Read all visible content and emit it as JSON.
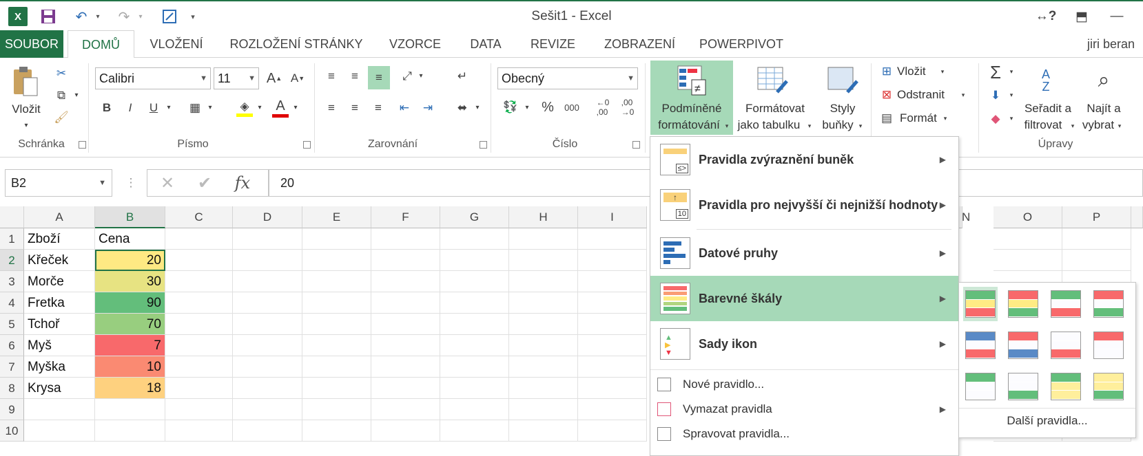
{
  "window": {
    "title": "Sešit1 - Excel",
    "user": "jiri beran"
  },
  "tabs": [
    "SOUBOR",
    "DOMŮ",
    "VLOŽENÍ",
    "ROZLOŽENÍ STRÁNKY",
    "VZORCE",
    "DATA",
    "REVIZE",
    "ZOBRAZENÍ",
    "POWERPIVOT"
  ],
  "ribbon": {
    "groups": [
      "Schránka",
      "Písmo",
      "Zarovnání",
      "Číslo",
      "Úpravy"
    ],
    "paste_label": "Vložit",
    "font_name": "Calibri",
    "font_size": "11",
    "number_format": "Obecný",
    "cond_format_line1": "Podmíněné",
    "cond_format_line2": "formátování",
    "format_table_line1": "Formátovat",
    "format_table_line2": "jako tabulku",
    "cell_styles_line1": "Styly",
    "cell_styles_line2": "buňky",
    "insert_label": "Vložit",
    "delete_label": "Odstranit",
    "format_label": "Formát",
    "sort_line1": "Seřadit a",
    "sort_line2": "filtrovat",
    "find_line1": "Najít a",
    "find_line2": "vybrat",
    "bold": "B",
    "italic": "I",
    "underline": "U"
  },
  "formula_bar": {
    "name_box": "B2",
    "fx": "fx",
    "value": "20"
  },
  "columns": [
    "A",
    "B",
    "C",
    "D",
    "E",
    "F",
    "G",
    "H",
    "I",
    "N",
    "O",
    "P"
  ],
  "rows": [
    "1",
    "2",
    "3",
    "4",
    "5",
    "6",
    "7",
    "8",
    "9",
    "10"
  ],
  "data": [
    {
      "a": "Zboží",
      "b": "Cena",
      "color": ""
    },
    {
      "a": "Křeček",
      "b": "20",
      "color": "#fee983"
    },
    {
      "a": "Morče",
      "b": "30",
      "color": "#e7e382"
    },
    {
      "a": "Fretka",
      "b": "90",
      "color": "#63be7b"
    },
    {
      "a": "Tchoř",
      "b": "70",
      "color": "#98ce7f"
    },
    {
      "a": "Myš",
      "b": "7",
      "color": "#f8696b"
    },
    {
      "a": "Myška",
      "b": "10",
      "color": "#fa8a72"
    },
    {
      "a": "Krysa",
      "b": "18",
      "color": "#fed17f"
    }
  ],
  "menu": {
    "items": [
      "Pravidla zvýraznění buněk",
      "Pravidla pro nejvyšší či nejnižší hodnoty",
      "Datové pruhy",
      "Barevné škály",
      "Sady ikon"
    ],
    "small_items": [
      "Nové pravidlo...",
      "Vymazat pravidla",
      "Spravovat pravidla..."
    ],
    "more_rules": "Další pravidla..."
  },
  "color_scales": [
    [
      "#63be7b",
      "#ffeb84",
      "#f8696b"
    ],
    [
      "#f8696b",
      "#ffeb84",
      "#63be7b"
    ],
    [
      "#63be7b",
      "#fcfcff",
      "#f8696b"
    ],
    [
      "#f8696b",
      "#fcfcff",
      "#63be7b"
    ],
    [
      "#5a8ac6",
      "#fcfcff",
      "#f8696b"
    ],
    [
      "#f8696b",
      "#fcfcff",
      "#5a8ac6"
    ],
    [
      "#fcfcff",
      "#fcfcff",
      "#f8696b"
    ],
    [
      "#f8696b",
      "#fcfcff",
      "#fcfcff"
    ],
    [
      "#63be7b",
      "#fcfcff",
      "#fcfcff"
    ],
    [
      "#fcfcff",
      "#fcfcff",
      "#63be7b"
    ],
    [
      "#63be7b",
      "#ffef9c",
      "#ffef9c"
    ],
    [
      "#ffef9c",
      "#ffef9c",
      "#63be7b"
    ]
  ]
}
